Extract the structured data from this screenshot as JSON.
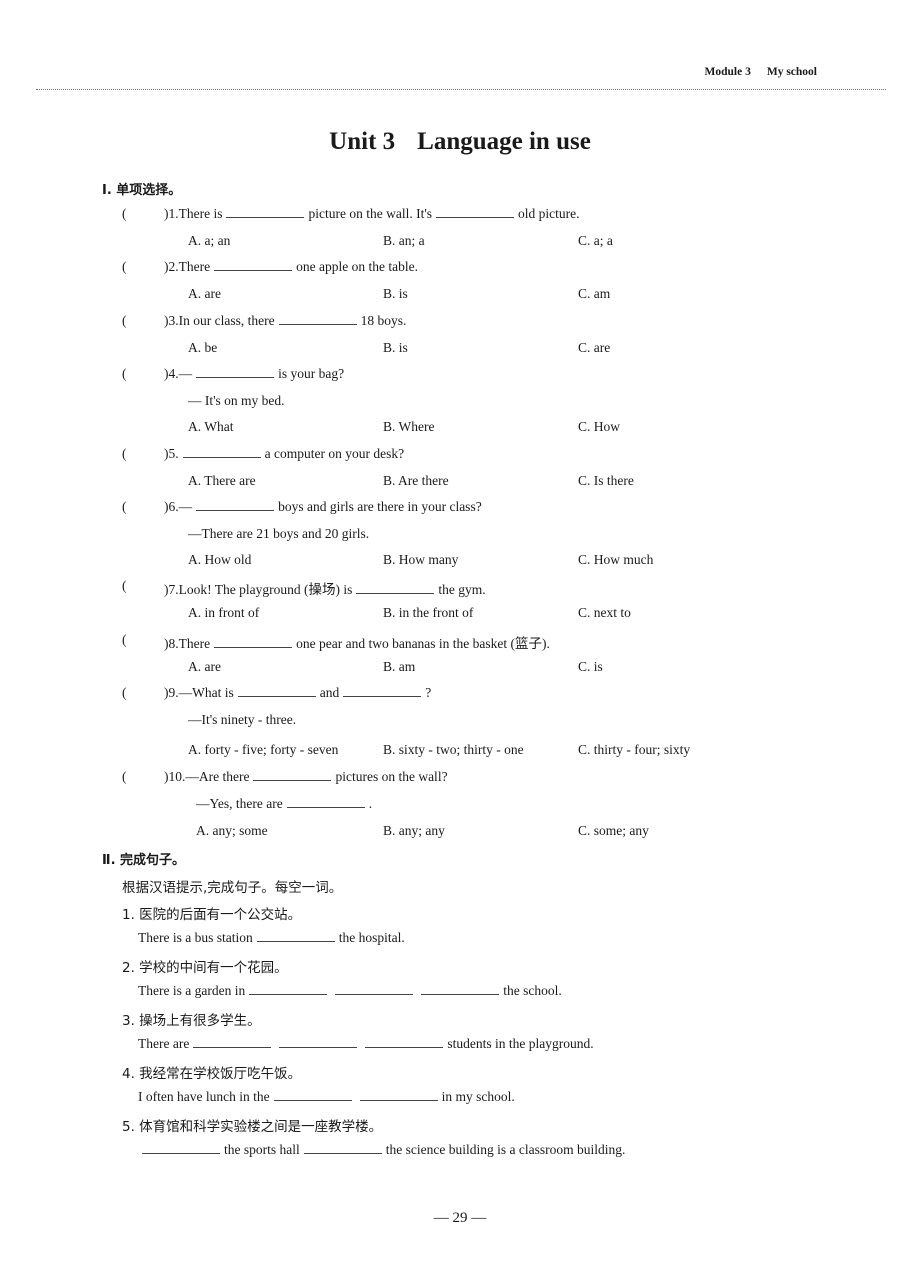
{
  "header": {
    "module": "Module 3",
    "module_title": "My school"
  },
  "title": {
    "unit": "Unit 3",
    "name": "Language in use"
  },
  "section1": {
    "heading": "Ⅰ. 单项选择。",
    "questions": [
      {
        "num": ")1.",
        "parts": [
          "There is",
          "picture on the wall. It's",
          "old picture."
        ],
        "options": [
          "A. a; an",
          "B. an; a",
          "C. a; a"
        ]
      },
      {
        "num": ")2.",
        "parts": [
          "There",
          "one apple on the table."
        ],
        "options": [
          "A. are",
          "B. is",
          "C. am"
        ]
      },
      {
        "num": ")3.",
        "parts": [
          "In our class, there",
          "18 boys."
        ],
        "options": [
          "A. be",
          "B. is",
          "C. are"
        ]
      },
      {
        "num": ")4.",
        "parts": [
          "—",
          "is your bag?"
        ],
        "reply": "— It's on my bed.",
        "options": [
          "A. What",
          "B. Where",
          "C. How"
        ]
      },
      {
        "num": ")5.",
        "parts": [
          "",
          "a computer on your desk?"
        ],
        "options": [
          "A. There are",
          "B. Are there",
          "C. Is there"
        ]
      },
      {
        "num": ")6.",
        "parts": [
          "—",
          "boys and girls are there in your class?"
        ],
        "reply": "—There are 21 boys and 20 girls.",
        "options": [
          "A. How old",
          "B. How many",
          "C. How much"
        ]
      },
      {
        "num": ")7.",
        "parts": [
          "Look! The playground (操场) is",
          "the gym."
        ],
        "options": [
          "A. in front of",
          "B. in the front of",
          "C. next to"
        ]
      },
      {
        "num": ")8.",
        "parts": [
          "There",
          "one pear and two bananas in the basket (篮子)."
        ],
        "options": [
          "A. are",
          "B. am",
          "C. is"
        ]
      },
      {
        "num": ")9.",
        "parts": [
          "—What is",
          "and",
          "?"
        ],
        "reply": "—It's ninety - three.",
        "options": [
          "A. forty - five; forty - seven",
          "B. sixty - two; thirty - one",
          "C. thirty - four; sixty"
        ]
      },
      {
        "num": ")10.",
        "parts": [
          "—Are there",
          "pictures on the wall?"
        ],
        "reply_parts": [
          "—Yes, there are",
          "."
        ],
        "options": [
          "A. any; some",
          "B. any; any",
          "C. some; any"
        ]
      }
    ]
  },
  "section2": {
    "heading": "Ⅱ. 完成句子。",
    "instruction": "根据汉语提示,完成句子。每空一词。",
    "items": [
      {
        "cn": "1. 医院的后面有一个公交站。",
        "en_parts": [
          "There is a bus station",
          "the hospital."
        ]
      },
      {
        "cn": "2. 学校的中间有一个花园。",
        "en_parts": [
          "There is a garden in",
          "",
          "",
          "the school."
        ]
      },
      {
        "cn": "3. 操场上有很多学生。",
        "en_parts": [
          "There are",
          "",
          "",
          "students in the playground."
        ]
      },
      {
        "cn": "4. 我经常在学校饭厅吃午饭。",
        "en_parts": [
          "I often have lunch in the",
          "",
          "in my school."
        ]
      },
      {
        "cn": "5. 体育馆和科学实验楼之间是一座教学楼。",
        "en_parts": [
          "",
          "the sports hall",
          "the science building is a classroom building."
        ]
      }
    ]
  },
  "footer": {
    "page": "— 29 —"
  }
}
